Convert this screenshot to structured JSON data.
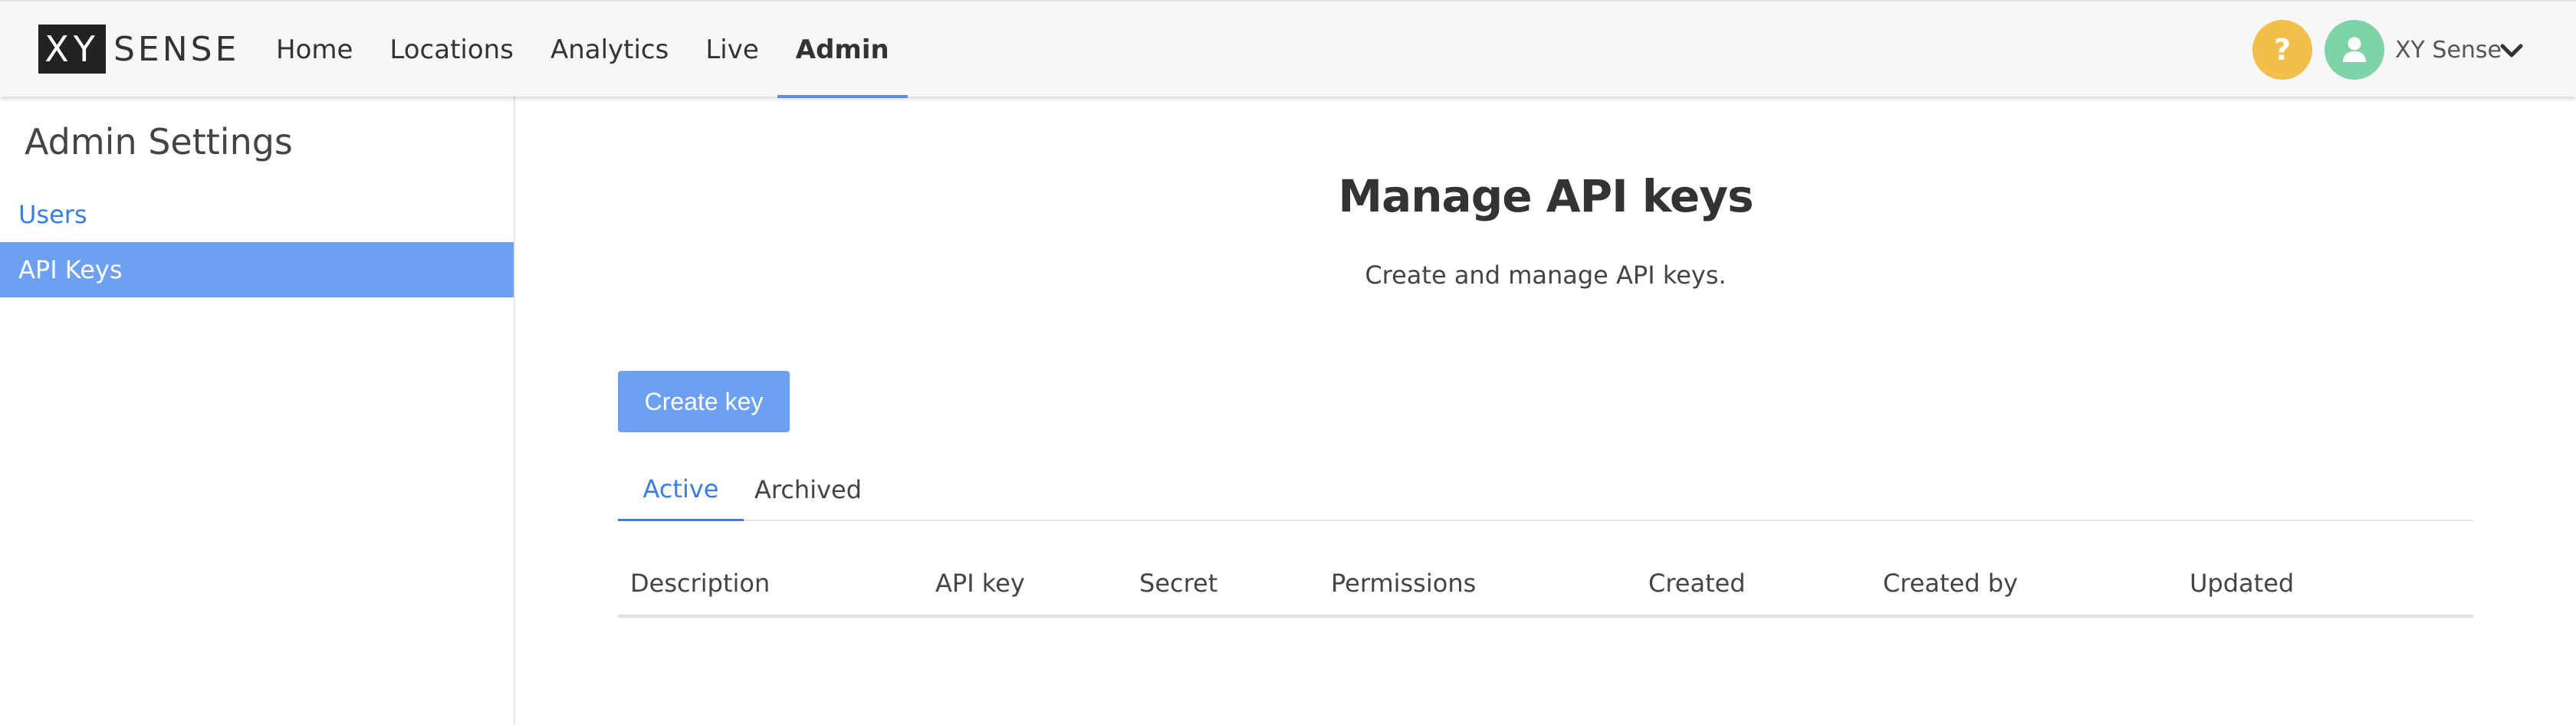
{
  "brand": {
    "logo_box_text": "XY",
    "logo_rest_text": "SENSE"
  },
  "nav": {
    "items": [
      {
        "label": "Home",
        "active": false
      },
      {
        "label": "Locations",
        "active": false
      },
      {
        "label": "Analytics",
        "active": false
      },
      {
        "label": "Live",
        "active": false
      },
      {
        "label": "Admin",
        "active": true
      }
    ]
  },
  "header": {
    "help_glyph": "?",
    "user_name": "XY Sense",
    "help_icon": "question-icon",
    "avatar_icon": "user-icon",
    "dropdown_icon": "chevron-down-icon"
  },
  "sidebar": {
    "title": "Admin Settings",
    "items": [
      {
        "label": "Users",
        "active": false
      },
      {
        "label": "API Keys",
        "active": true
      }
    ]
  },
  "main": {
    "title": "Manage API keys",
    "subtitle": "Create and manage API keys.",
    "create_button_label": "Create key",
    "tabs": [
      {
        "label": "Active",
        "active": true
      },
      {
        "label": "Archived",
        "active": false
      }
    ],
    "table": {
      "columns": [
        "Description",
        "API key",
        "Secret",
        "Permissions",
        "Created",
        "Created by",
        "Updated"
      ],
      "rows": []
    }
  },
  "colors": {
    "accent": "#5b8def",
    "link": "#3b7de0",
    "selected_bg": "#6ea0f2",
    "help_bg": "#f2c04a",
    "avatar_bg": "#7fd3a9"
  }
}
